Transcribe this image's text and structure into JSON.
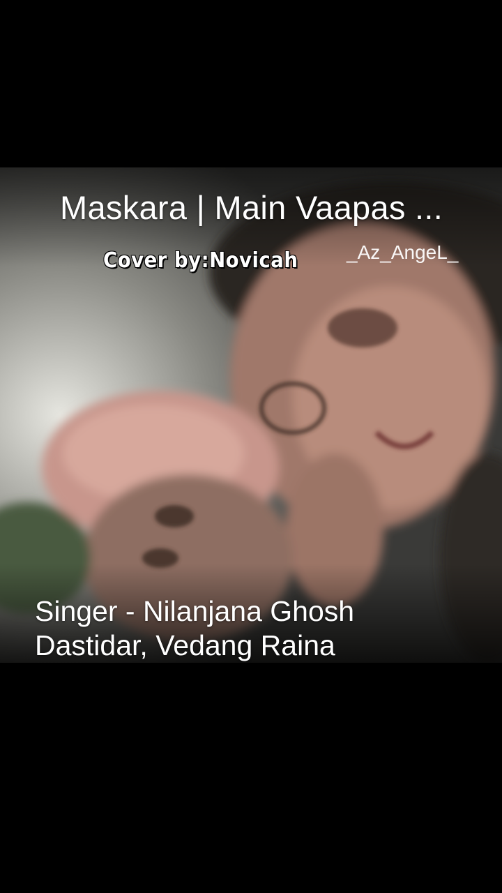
{
  "video": {
    "title": "Maskara | Main Vaapas ...",
    "cover_credit": "Cover  by:Novicah",
    "watermark": "_Az_AngeL_",
    "singer_line1": "Singer - Nilanjana Ghosh",
    "singer_line2": "Dastidar, Vedang Raina",
    "background_art": "blurred-photo-two-people-close-up"
  },
  "colors": {
    "letterbox": "#000000",
    "text": "#ffffff"
  }
}
